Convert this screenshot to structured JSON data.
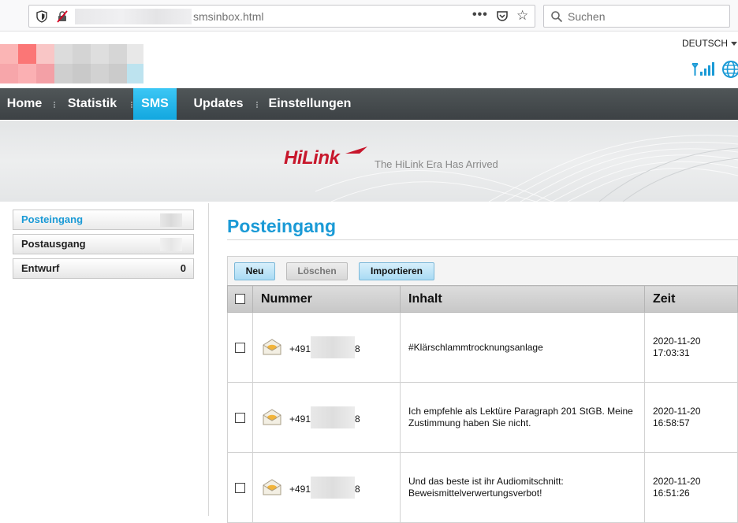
{
  "browser": {
    "url_visible": "smsinbox.html",
    "search_placeholder": "Suchen"
  },
  "header": {
    "language": "DEUTSCH"
  },
  "nav": {
    "items": [
      {
        "label": "Home"
      },
      {
        "label": "Statistik"
      },
      {
        "label": "SMS",
        "active": true
      },
      {
        "label": "Updates"
      },
      {
        "label": "Einstellungen"
      }
    ],
    "active_color": "#1ab0e8"
  },
  "banner": {
    "logo": "HiLink",
    "tagline": "The HiLink Era Has Arrived"
  },
  "sidebar": {
    "items": [
      {
        "label": "Posteingang",
        "count": "",
        "active": true
      },
      {
        "label": "Postausgang",
        "count": ""
      },
      {
        "label": "Entwurf",
        "count": "0"
      }
    ]
  },
  "main": {
    "title": "Posteingang",
    "buttons": {
      "new": "Neu",
      "delete": "Löschen",
      "import": "Importieren"
    },
    "table": {
      "columns": [
        "Nummer",
        "Inhalt",
        "Zeit"
      ],
      "rows": [
        {
          "number_prefix": "+491",
          "number_suffix": "8",
          "content": "#Klärschlammtrocknungsanlage",
          "date": "2020-11-20",
          "time": "17:03:31"
        },
        {
          "number_prefix": "+491",
          "number_suffix": "8",
          "content": "Ich empfehle als Lektüre Paragraph 201 StGB. Meine Zustimmung haben Sie nicht.",
          "date": "2020-11-20",
          "time": "16:58:57"
        },
        {
          "number_prefix": "+491",
          "number_suffix": "8",
          "content": "Und das beste ist ihr Audiomitschnitt: Beweismittelverwertungsverbot!",
          "date": "2020-11-20",
          "time": "16:51:26"
        }
      ]
    }
  },
  "colors": {
    "accent": "#1a9ad6",
    "nav_bg": "#464b4e",
    "brand_red": "#c7172c"
  }
}
